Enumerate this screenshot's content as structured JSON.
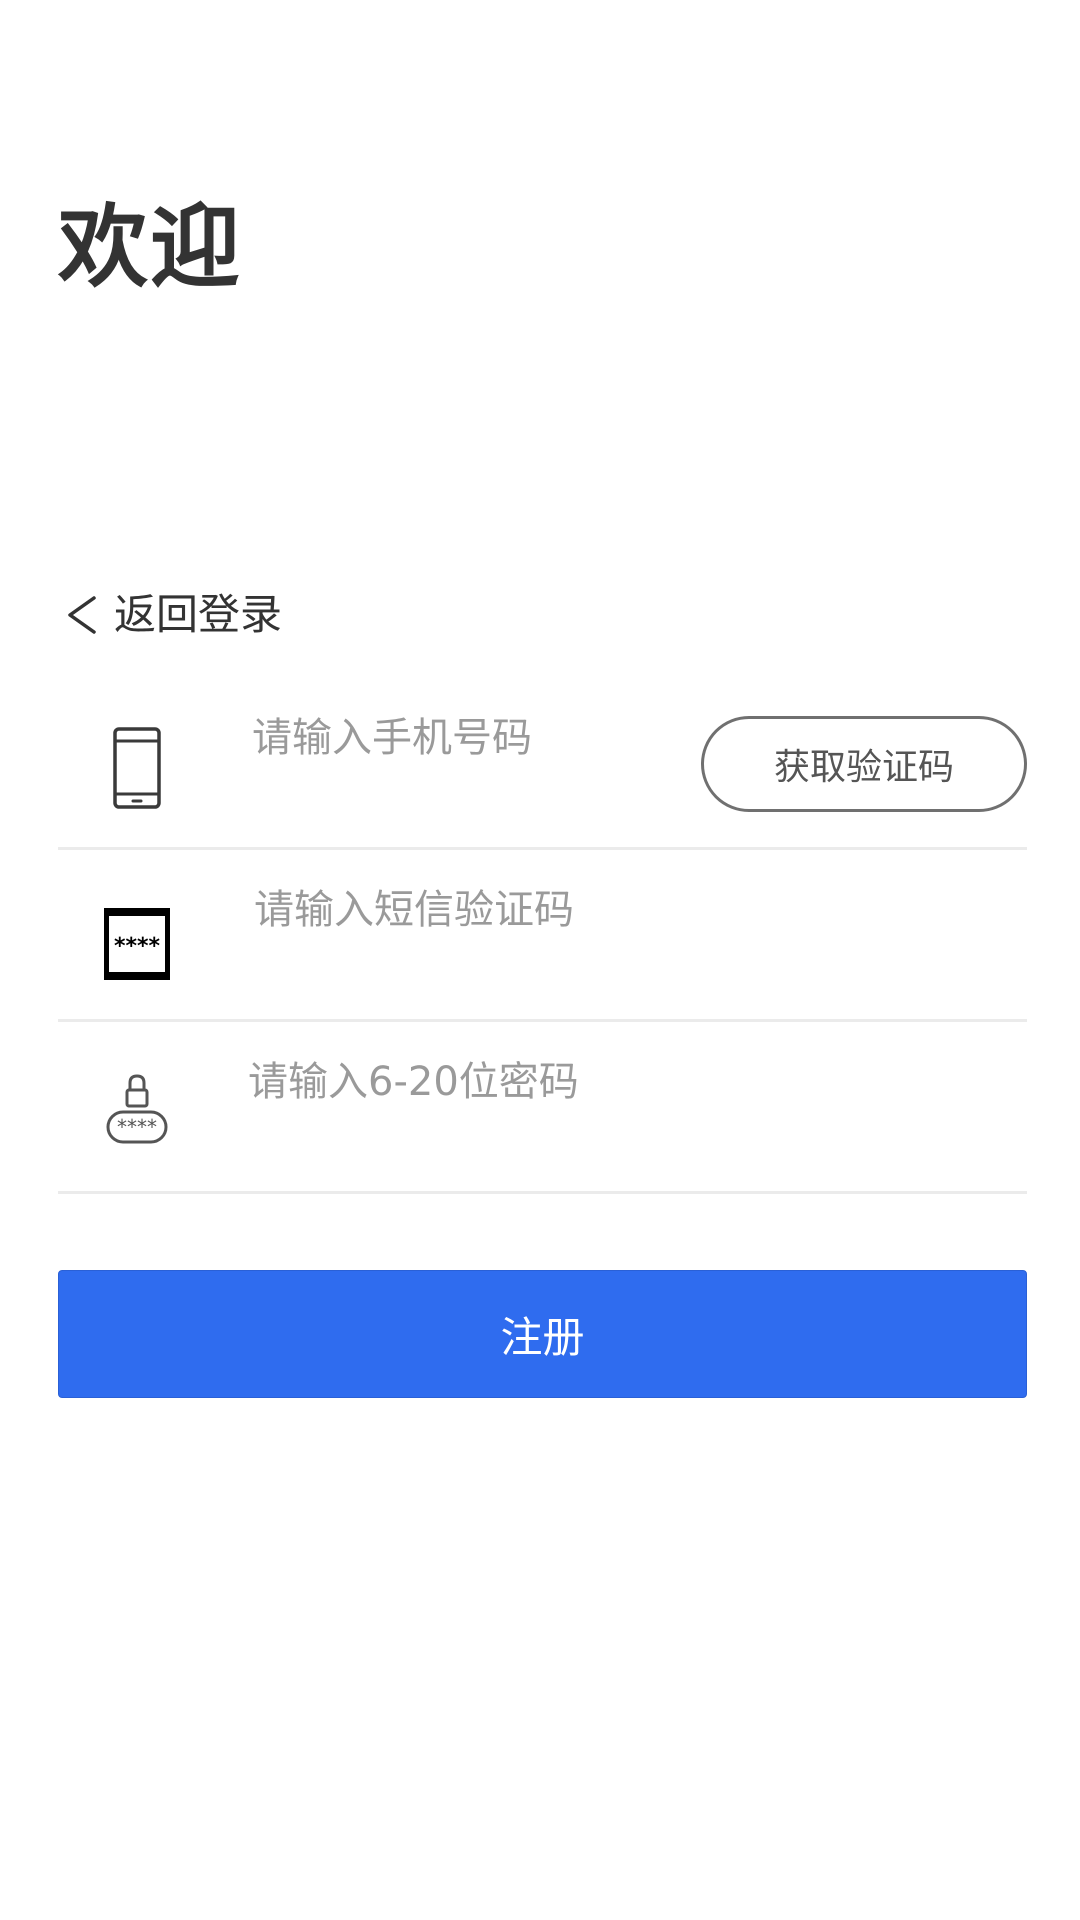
{
  "header": {
    "title": "欢迎"
  },
  "nav": {
    "back_label": "返回登录"
  },
  "form": {
    "phone": {
      "icon": "phone-icon",
      "placeholder": "请输入手机号码",
      "value": ""
    },
    "get_code_label": "获取验证码",
    "sms_code": {
      "icon": "sms-code-icon",
      "placeholder": "请输入短信验证码",
      "value": ""
    },
    "password": {
      "icon": "password-lock-icon",
      "placeholder": "请输入6-20位密码",
      "value": ""
    }
  },
  "actions": {
    "register_label": "注册"
  },
  "colors": {
    "primary": "#2f6cef",
    "text": "#333333",
    "placeholder": "#9a9a9a",
    "divider": "#ebebeb",
    "outline_button": "#707070"
  }
}
